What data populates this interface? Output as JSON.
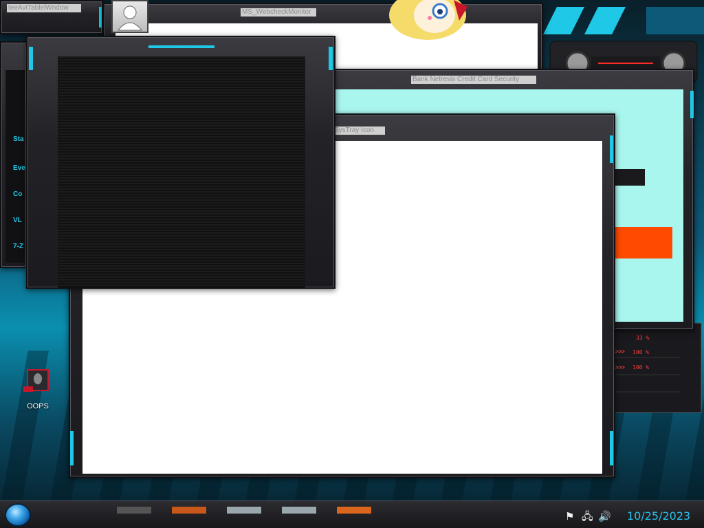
{
  "windows": {
    "top_left_title": "teeAvtTablelWndow",
    "webcheck_title": "MS_WebcheckMonitor",
    "security_title": "Bank Netresis Credit Card Security",
    "systray_title": "SysTray Icon"
  },
  "left_apps": {
    "items": [
      "Sta",
      "Eve",
      "Co",
      "VL",
      "7-Z"
    ]
  },
  "desktop": {
    "icons": [
      {
        "label": "OOPS",
        "icon": "alienware-icon"
      }
    ]
  },
  "widget": {
    "readouts": [
      "33 %",
      "100 %",
      "100 %"
    ],
    "arrows": ">>>>"
  },
  "taskbar": {
    "start_icon": "start-orb-icon",
    "tray_icons": [
      "flag-icon",
      "network-icon",
      "volume-icon"
    ],
    "clock_date": "10/25/2023"
  },
  "colors": {
    "accent_cyan": "#1ec8e6",
    "security_client_bg": "#a9f6ef",
    "security_alert": "#ff4a00",
    "gauge_red": "#ff3a3a",
    "clock_text": "#27bfe8"
  }
}
